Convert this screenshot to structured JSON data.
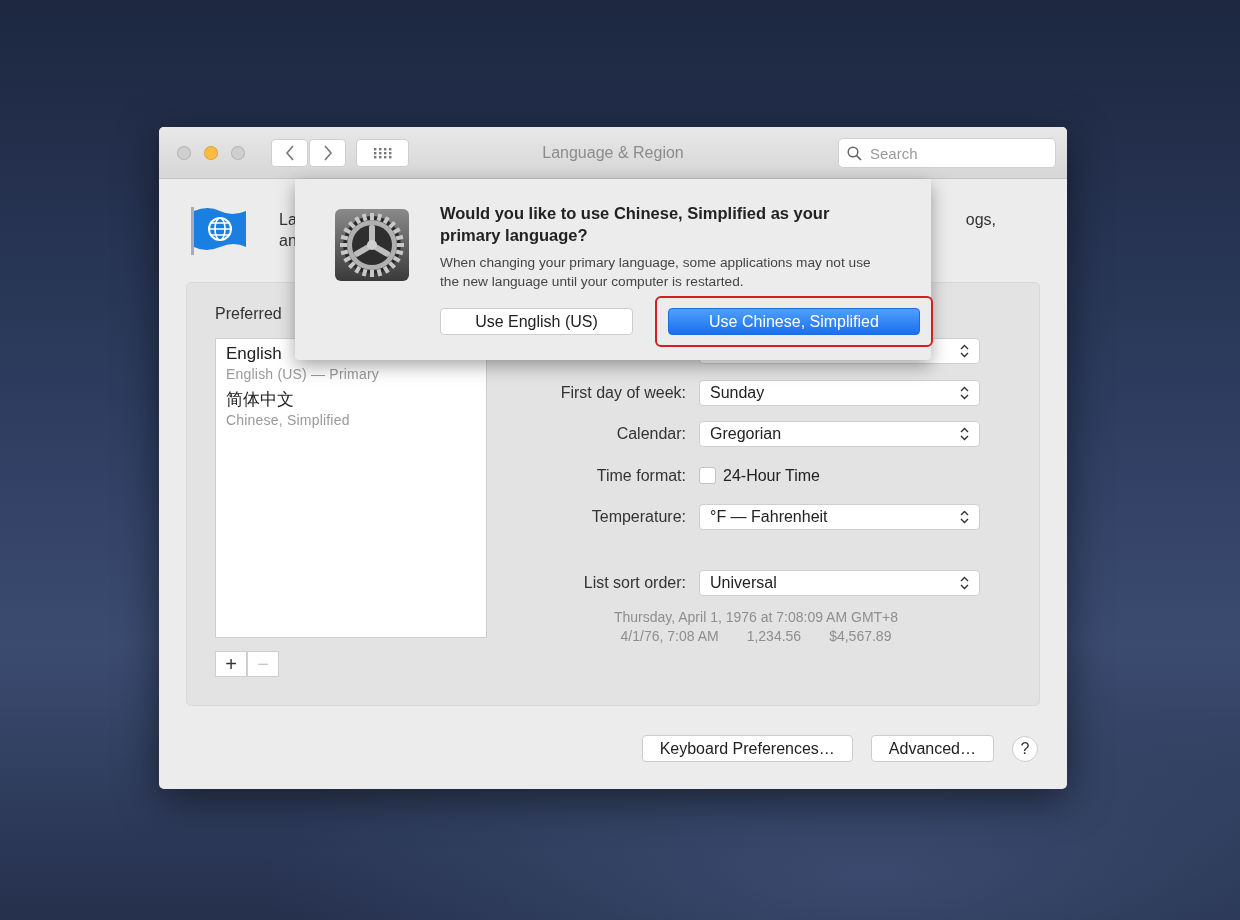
{
  "window": {
    "title": "Language & Region",
    "controls": [
      {
        "kind": "close",
        "active": false
      },
      {
        "kind": "minimize",
        "active": true
      },
      {
        "kind": "zoom",
        "active": false
      }
    ],
    "search": {
      "placeholder": "Search"
    }
  },
  "header": {
    "description_left": [
      "La",
      "an"
    ],
    "description_right": "ogs,"
  },
  "preferred_languages": {
    "heading": "Preferred",
    "items": [
      {
        "name": "English",
        "detail": "English (US) — Primary"
      },
      {
        "name": "简体中文",
        "detail": "Chinese, Simplified"
      }
    ],
    "buttons": [
      {
        "label": "+",
        "disabled": false
      },
      {
        "label": "−",
        "disabled": true
      }
    ]
  },
  "settings": [
    {
      "kind": "select"
    },
    {
      "kind": "select",
      "label": "First day of week:",
      "value": "Sunday"
    },
    {
      "kind": "select",
      "label": "Calendar:",
      "value": "Gregorian"
    },
    {
      "kind": "checkbox",
      "label": "Time format:",
      "value": "24-Hour Time",
      "checked": false
    },
    {
      "kind": "select",
      "label": "Temperature:",
      "value": "°F — Fahrenheit"
    }
  ],
  "sort_order": {
    "label": "List sort order:",
    "value": "Universal"
  },
  "sample": {
    "date_long": "Thursday, April 1, 1976 at 7:08:09 AM GMT+8",
    "parts": [
      "4/1/76, 7:08 AM",
      "1,234.56",
      "$4,567.89"
    ]
  },
  "footer_buttons": [
    "Keyboard Preferences…",
    "Advanced…"
  ],
  "help": "?",
  "alert": {
    "title": "Would you like to use Chinese, Simplified as your primary language?",
    "message": "When changing your primary language, some applications may not use the new language until your computer is restarted.",
    "buttons": [
      {
        "label": "Use English (US)",
        "default": false,
        "highlighted": false
      },
      {
        "label": "Use Chinese, Simplified",
        "default": true,
        "highlighted": true
      }
    ]
  }
}
